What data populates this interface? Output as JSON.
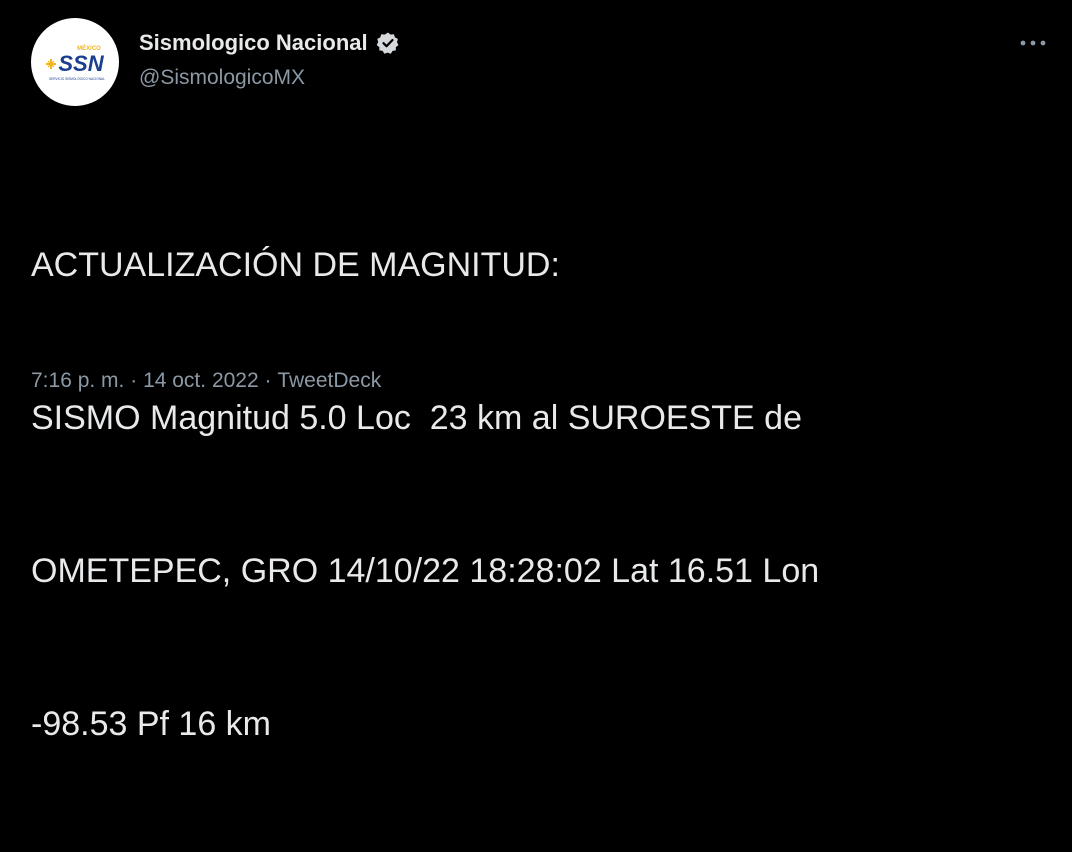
{
  "tweet": {
    "author": {
      "display_name": "Sismologico Nacional",
      "handle": "@SismologicoMX",
      "verified": true,
      "avatar": {
        "logo_text": "SSN",
        "logo_top_text": "MÉXICO",
        "logo_sub_text": "SERVICIO SISMOLÓGICO NACIONAL",
        "logo_text_color": "#1b3f8f",
        "logo_accent_color": "#f2b51c"
      }
    },
    "text_lines": [
      "ACTUALIZACIÓN DE MAGNITUD:",
      "SISMO Magnitud 5.0 Loc  23 km al SUROESTE de",
      "OMETEPEC, GRO 14/10/22 18:28:02 Lat 16.51 Lon",
      "-98.53 Pf 16 km"
    ],
    "meta": {
      "time": "7:16 p. m.",
      "separator": " · ",
      "date": "14 oct. 2022",
      "source": "TweetDeck"
    },
    "more_icon": "more-horizontal-icon",
    "verified_icon": "verified-badge-icon"
  },
  "colors": {
    "background": "#000000",
    "primary_text": "#e7e9ea",
    "secondary_text": "#8b98a5"
  }
}
